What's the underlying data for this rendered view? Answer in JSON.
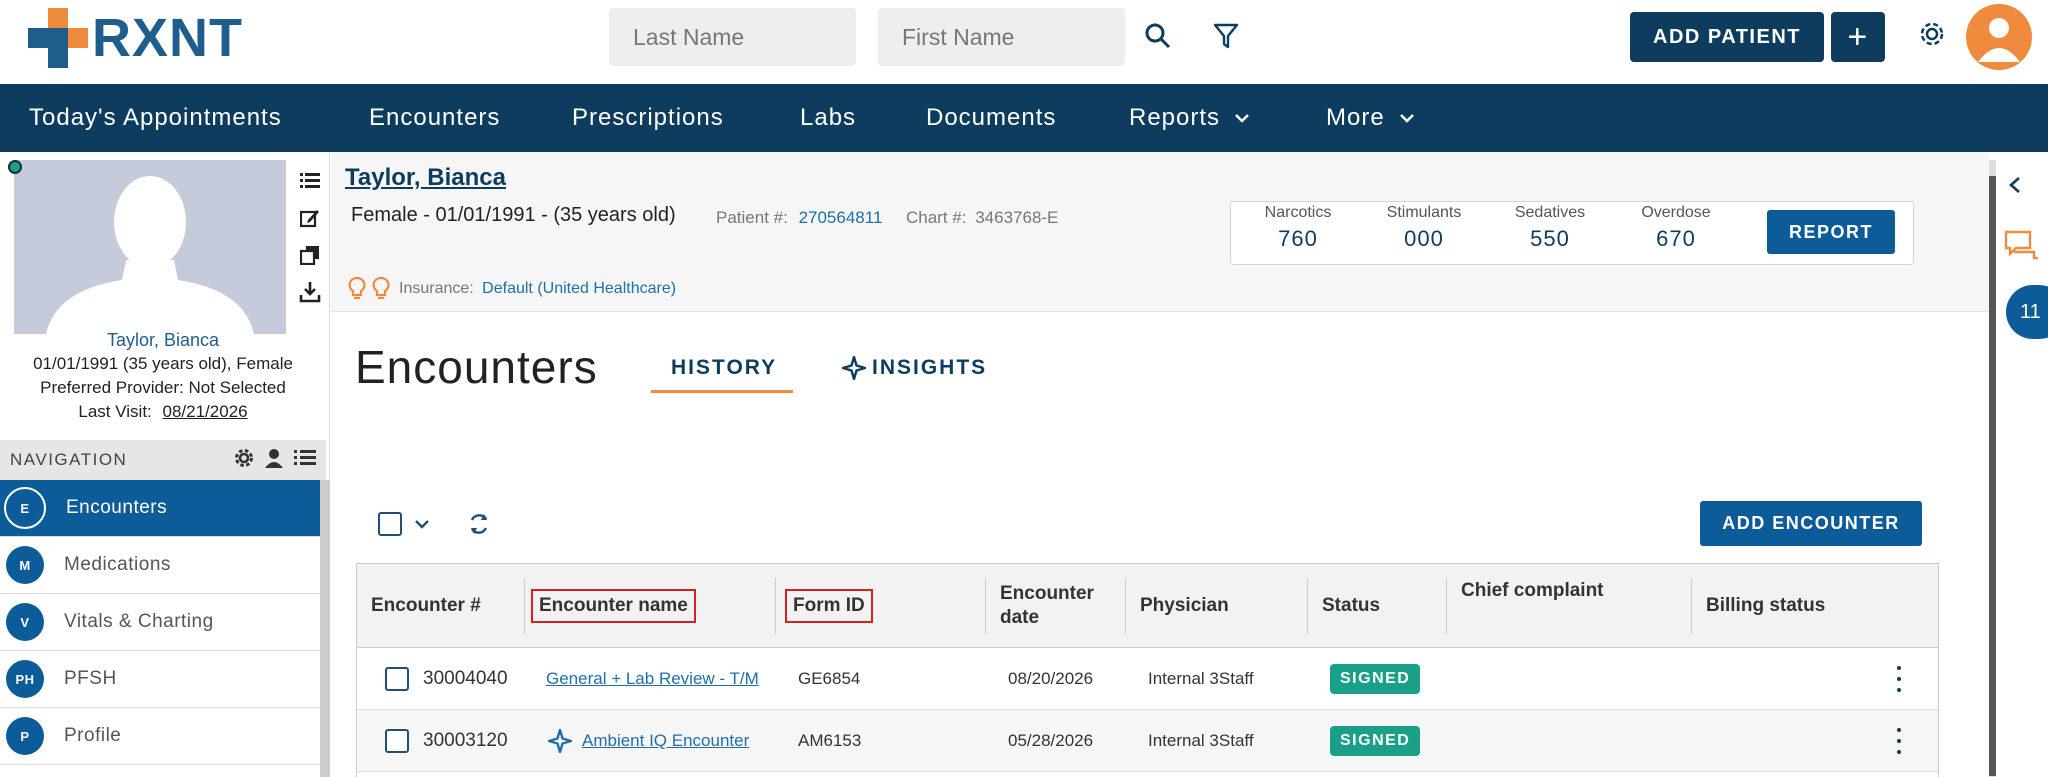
{
  "header": {
    "logo_text": "RXNT",
    "last_name_placeholder": "Last Name",
    "first_name_placeholder": "First Name",
    "add_patient_label": "ADD PATIENT",
    "add_button_symbol": "+"
  },
  "nav": {
    "items": [
      {
        "label": "Today's Appointments"
      },
      {
        "label": "Encounters"
      },
      {
        "label": "Prescriptions"
      },
      {
        "label": "Labs"
      },
      {
        "label": "Documents"
      },
      {
        "label": "Reports"
      },
      {
        "label": "More"
      }
    ]
  },
  "patient_card": {
    "name": "Taylor, Bianca",
    "dob_line": "01/01/1991 (35 years old), Female",
    "provider_line": "Preferred Provider: Not Selected",
    "last_visit_label": "Last Visit:",
    "last_visit_date": "08/21/2026"
  },
  "side_nav": {
    "title": "NAVIGATION",
    "items": [
      {
        "abbr": "E",
        "label": "Encounters",
        "active": true
      },
      {
        "abbr": "M",
        "label": "Medications"
      },
      {
        "abbr": "V",
        "label": "Vitals & Charting"
      },
      {
        "abbr": "PH",
        "label": "PFSH"
      },
      {
        "abbr": "P",
        "label": "Profile"
      }
    ]
  },
  "patient_header": {
    "name": "Taylor, Bianca",
    "demographics": "Female - 01/01/1991 - (35 years old)",
    "patient_num_label": "Patient #:",
    "patient_num": "270564811",
    "chart_num_label": "Chart #:",
    "chart_num": "3463768-E",
    "insurance_label": "Insurance:",
    "insurance_value": "Default (United Healthcare)"
  },
  "pdmp": {
    "scores": [
      {
        "label": "Narcotics",
        "value": "760"
      },
      {
        "label": "Stimulants",
        "value": "000"
      },
      {
        "label": "Sedatives",
        "value": "550"
      },
      {
        "label": "Overdose",
        "value": "670"
      }
    ],
    "report_label": "REPORT"
  },
  "encounters": {
    "title": "Encounters",
    "tabs": [
      {
        "label": "HISTORY",
        "active": true
      },
      {
        "label": "INSIGHTS"
      }
    ],
    "add_label": "ADD ENCOUNTER",
    "columns": [
      "Encounter #",
      "Encounter name",
      "Form ID",
      "Encounter date",
      "Physician",
      "Status",
      "Chief complaint",
      "Billing status"
    ],
    "rows": [
      {
        "number": "30004040",
        "name": "General + Lab Review - T/M",
        "form_id": "GE6854",
        "date": "08/20/2026",
        "physician": "Internal 3Staff",
        "status": "SIGNED",
        "chief_complaint": "",
        "billing_status": ""
      },
      {
        "number": "30003120",
        "name": "Ambient IQ Encounter",
        "form_id": "AM6153",
        "date": "05/28/2026",
        "physician": "Internal 3Staff",
        "status": "SIGNED",
        "chief_complaint": "",
        "billing_status": ""
      }
    ]
  },
  "right_rail": {
    "message_count": "11"
  },
  "colors": {
    "brand_navy": "#0d3c5e",
    "brand_blue": "#0d5c9a",
    "accent_orange": "#f08a3c",
    "signed_green": "#1aa089",
    "highlight_red": "#d32222"
  }
}
